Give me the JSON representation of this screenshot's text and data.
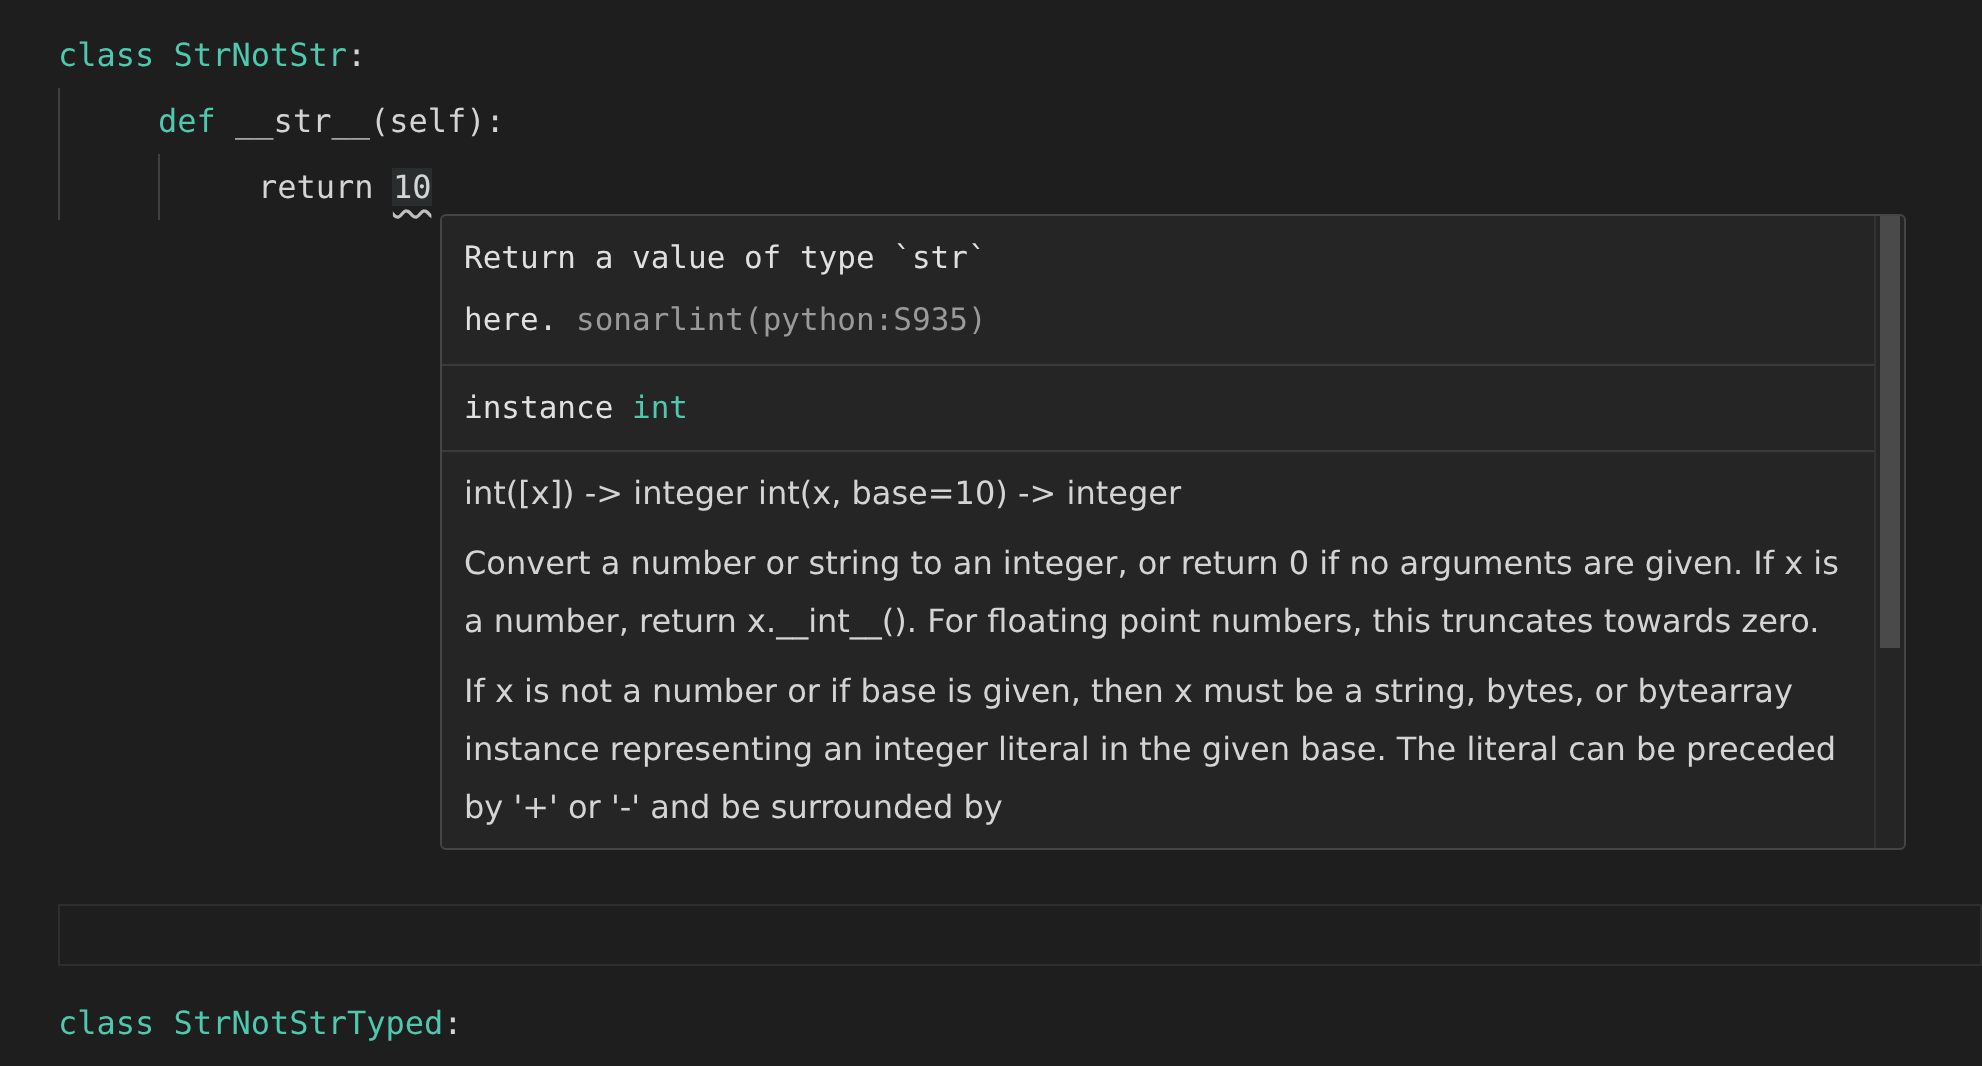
{
  "editor": {
    "lines": [
      {
        "tokens": [
          {
            "text": "class",
            "kind": "keyword"
          },
          {
            "text": " StrNotStr",
            "kind": "keyword"
          },
          {
            "text": ":"
          }
        ],
        "children": [
          {
            "tokens": [
              {
                "text": "def",
                "kind": "keyword"
              },
              {
                "text": " __str__(self):"
              }
            ],
            "children": [
              {
                "tokens": [
                  {
                    "text": "return "
                  },
                  {
                    "text": "10",
                    "flagged": true
                  }
                ]
              }
            ]
          }
        ]
      },
      {
        "current": true
      },
      {
        "tokens": [
          {
            "text": "class",
            "kind": "keyword"
          },
          {
            "text": " StrNotStrTyped",
            "kind": "keyword"
          },
          {
            "text": ":"
          }
        ]
      }
    ]
  },
  "hover": {
    "message": "Return a value of type `str` here.",
    "source": "sonarlint(python:S935)",
    "type_label": "instance",
    "type_name": "int",
    "signature": "int([x]) -> integer int(x, base=10) -> integer",
    "paragraphs": [
      "Convert a number or string to an integer, or return 0 if no arguments are given. If x is a number, return x.__int__(). For floating point numbers, this truncates towards zero.",
      "If x is not a number or if base is given, then x must be a string, bytes, or bytearray instance representing an integer literal in the given base. The literal can be preceded by '+' or '-' and be surrounded by"
    ]
  }
}
